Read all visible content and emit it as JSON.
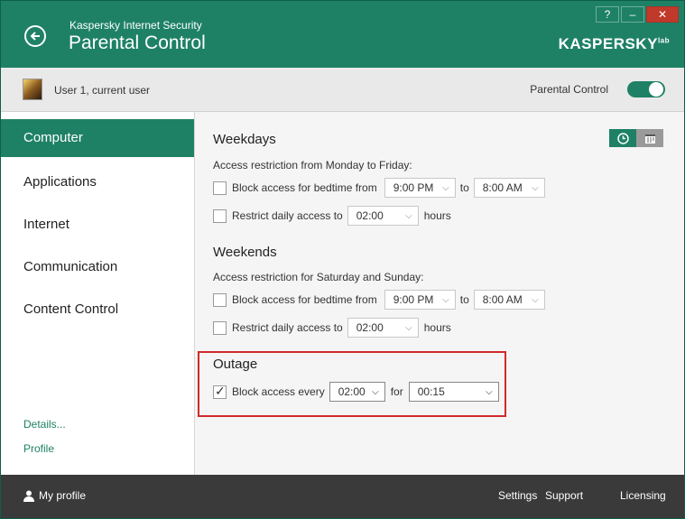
{
  "window": {
    "subtitle": "Kaspersky Internet Security",
    "title": "Parental Control",
    "logo": "KASPERSKY",
    "logo_suffix": "lab",
    "help_glyph": "?",
    "minimize_glyph": "–",
    "close_glyph": "✕"
  },
  "userbar": {
    "user": "User 1, current user",
    "toggle_label": "Parental Control",
    "toggle_on": true
  },
  "sidebar": {
    "items": [
      {
        "label": "Computer",
        "active": true
      },
      {
        "label": "Applications"
      },
      {
        "label": "Internet"
      },
      {
        "label": "Communication"
      },
      {
        "label": "Content Control"
      }
    ],
    "details_link": "Details...",
    "profile_link": "Profile"
  },
  "weekdays": {
    "title": "Weekdays",
    "description": "Access restriction from Monday to Friday:",
    "bedtime": {
      "label": "Block access for bedtime from",
      "from": "9:00 PM",
      "to_label": "to",
      "to": "8:00 AM",
      "checked": false
    },
    "daily": {
      "label": "Restrict daily access to",
      "value": "02:00",
      "unit": "hours",
      "checked": false
    }
  },
  "weekends": {
    "title": "Weekends",
    "description": "Access restriction for Saturday and Sunday:",
    "bedtime": {
      "label": "Block access for bedtime from",
      "from": "9:00 PM",
      "to_label": "to",
      "to": "8:00 AM",
      "checked": false
    },
    "daily": {
      "label": "Restrict daily access to",
      "value": "02:00",
      "unit": "hours",
      "checked": false
    }
  },
  "outage": {
    "title": "Outage",
    "label": "Block access every",
    "every": "02:00",
    "for_label": "for",
    "duration": "00:15",
    "checked": true
  },
  "footer": {
    "my_profile": "My profile",
    "settings": "Settings",
    "support": "Support",
    "licensing": "Licensing"
  },
  "colors": {
    "accent": "#1e8165",
    "highlight_border": "#d02a2a",
    "footer_bg": "#3a3a3a"
  }
}
